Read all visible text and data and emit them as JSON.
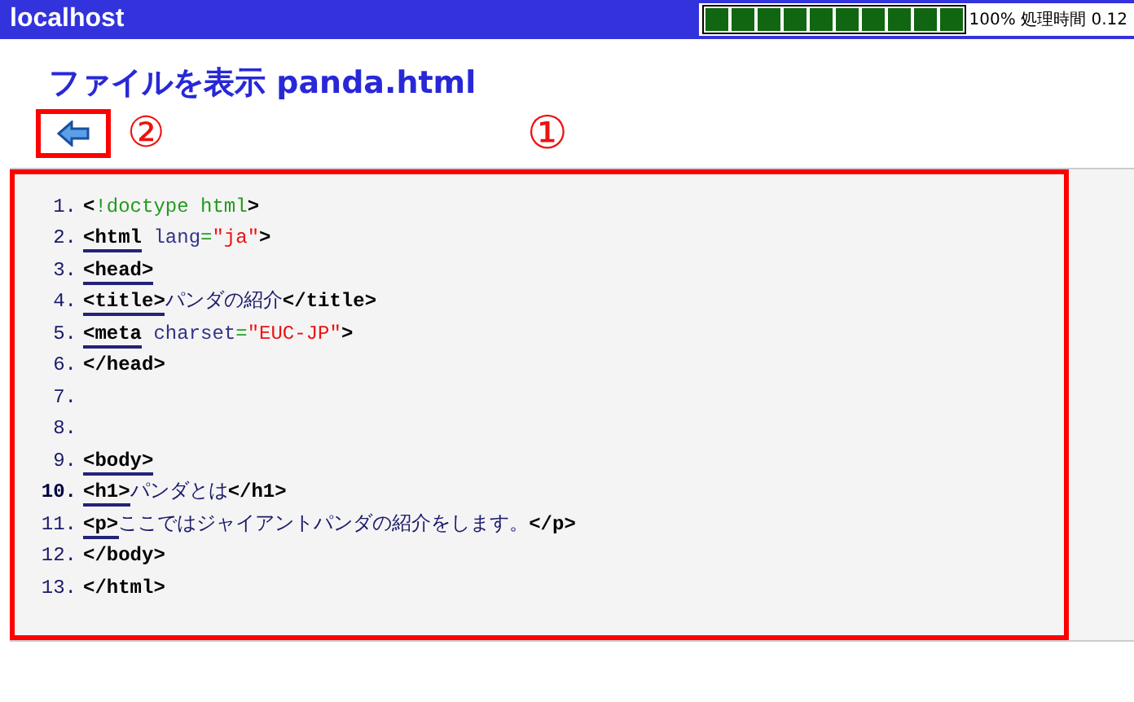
{
  "header": {
    "host": "localhost",
    "progress": {
      "reading": "100% 処理時間 0.12"
    }
  },
  "title": "ファイルを表示 panda.html",
  "annotations": [
    "②",
    "①"
  ],
  "code": {
    "lines": [
      {
        "number": "1.",
        "highlighted": false,
        "tokens": [
          {
            "kind": "punct",
            "text": "<"
          },
          {
            "kind": "doctype",
            "text": "!doctype html"
          },
          {
            "kind": "punct",
            "text": ">"
          }
        ]
      },
      {
        "number": "2.",
        "highlighted": false,
        "tokens": [
          {
            "kind": "link",
            "text": "<html"
          },
          {
            "kind": "attr",
            "text": " lang"
          },
          {
            "kind": "eq",
            "text": "="
          },
          {
            "kind": "value",
            "text": "\"ja\""
          },
          {
            "kind": "punct",
            "text": ">"
          }
        ]
      },
      {
        "number": "3.",
        "highlighted": false,
        "tokens": [
          {
            "kind": "link",
            "text": "<head>"
          }
        ]
      },
      {
        "number": "4.",
        "highlighted": false,
        "tokens": [
          {
            "kind": "link",
            "text": "<title>"
          },
          {
            "kind": "text",
            "text": "パンダの紹介"
          },
          {
            "kind": "punct",
            "text": "</title>"
          }
        ]
      },
      {
        "number": "5.",
        "highlighted": false,
        "tokens": [
          {
            "kind": "link",
            "text": "<meta"
          },
          {
            "kind": "attr",
            "text": " charset"
          },
          {
            "kind": "eq",
            "text": "="
          },
          {
            "kind": "value",
            "text": "\"EUC-JP\""
          },
          {
            "kind": "punct",
            "text": ">"
          }
        ]
      },
      {
        "number": "6.",
        "highlighted": false,
        "tokens": [
          {
            "kind": "punct",
            "text": "</head>"
          }
        ]
      },
      {
        "number": "7.",
        "highlighted": false
      },
      {
        "number": "8.",
        "highlighted": false
      },
      {
        "number": "9.",
        "highlighted": false,
        "tokens": [
          {
            "kind": "link",
            "text": "<body>"
          }
        ]
      },
      {
        "number": "10.",
        "highlighted": true,
        "tokens": [
          {
            "kind": "link",
            "text": "<h1>"
          },
          {
            "kind": "text",
            "text": "パンダとは"
          },
          {
            "kind": "punct",
            "text": "</h1>"
          }
        ]
      },
      {
        "number": "11.",
        "highlighted": false,
        "tokens": [
          {
            "kind": "link",
            "text": "<p>"
          },
          {
            "kind": "text",
            "text": "ここではジャイアントパンダの紹介をします。"
          },
          {
            "kind": "punct",
            "text": "</p>"
          }
        ]
      },
      {
        "number": "12.",
        "highlighted": false,
        "tokens": [
          {
            "kind": "punct",
            "text": "</body>"
          }
        ]
      },
      {
        "number": "13.",
        "highlighted": false,
        "tokens": [
          {
            "kind": "punct",
            "text": "</html>"
          }
        ]
      }
    ]
  }
}
